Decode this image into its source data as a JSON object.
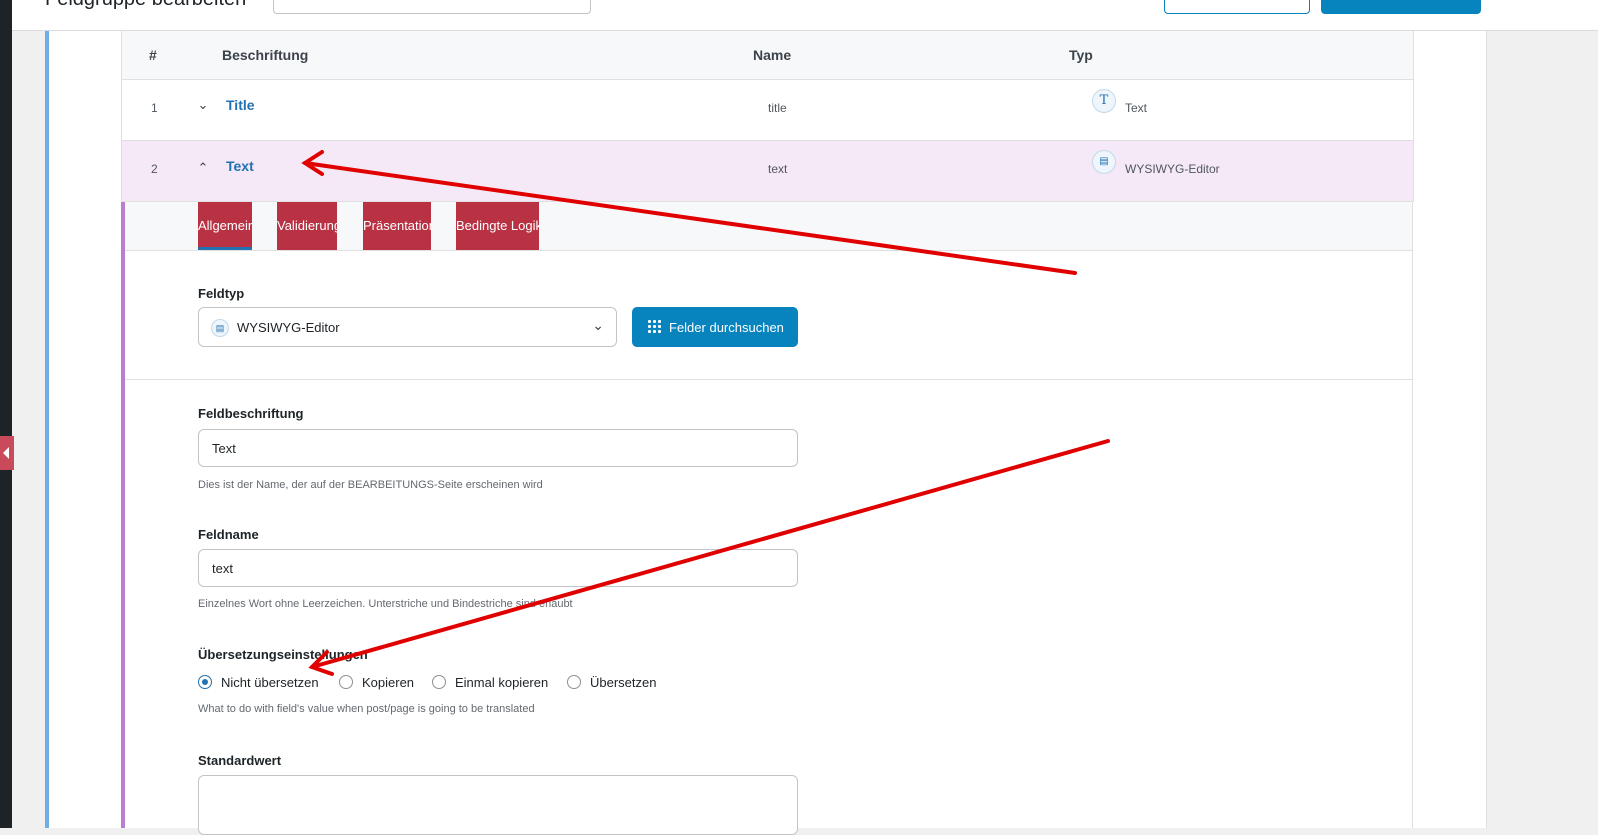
{
  "header": {
    "title": "Feldgruppe bearbeiten"
  },
  "table": {
    "columns": {
      "num": "#",
      "label": "Beschriftung",
      "name": "Name",
      "type": "Typ"
    },
    "rows": [
      {
        "num": "1",
        "label": "Title",
        "name": "title",
        "type": "Text",
        "type_icon": "text-type-icon",
        "expanded": false
      },
      {
        "num": "2",
        "label": "Text",
        "name": "text",
        "type": "WYSIWYG-Editor",
        "type_icon": "wysiwyg-type-icon",
        "expanded": true
      }
    ]
  },
  "tabs": [
    {
      "label": "Allgemein",
      "active": true
    },
    {
      "label": "Validierung",
      "active": false
    },
    {
      "label": "Präsentation",
      "active": false
    },
    {
      "label": "Bedingte Logik",
      "active": false
    }
  ],
  "field_type": {
    "label": "Feldtyp",
    "value": "WYSIWYG-Editor",
    "browse_button": "Felder durchsuchen"
  },
  "field_label": {
    "label": "Feldbeschriftung",
    "value": "Text",
    "help": "Dies ist der Name, der auf der BEARBEITUNGS-Seite erscheinen wird"
  },
  "field_name": {
    "label": "Feldname",
    "value": "text",
    "help": "Einzelnes Wort ohne Leerzeichen. Unterstriche und Bindestriche sind erlaubt"
  },
  "translation": {
    "label": "Übersetzungseinstellungen",
    "options": [
      {
        "label": "Nicht übersetzen",
        "selected": true
      },
      {
        "label": "Kopieren",
        "selected": false
      },
      {
        "label": "Einmal kopieren",
        "selected": false
      },
      {
        "label": "Übersetzen",
        "selected": false
      }
    ],
    "help": "What to do with field's value when post/page is going to be translated"
  },
  "default_value": {
    "label": "Standardwert"
  },
  "colors": {
    "accent": "#2271b1",
    "primary_button": "#0783be",
    "tab_bg": "#b83244",
    "expanded_row": "#f5e8f7",
    "annotation_arrow": "#e00000"
  }
}
